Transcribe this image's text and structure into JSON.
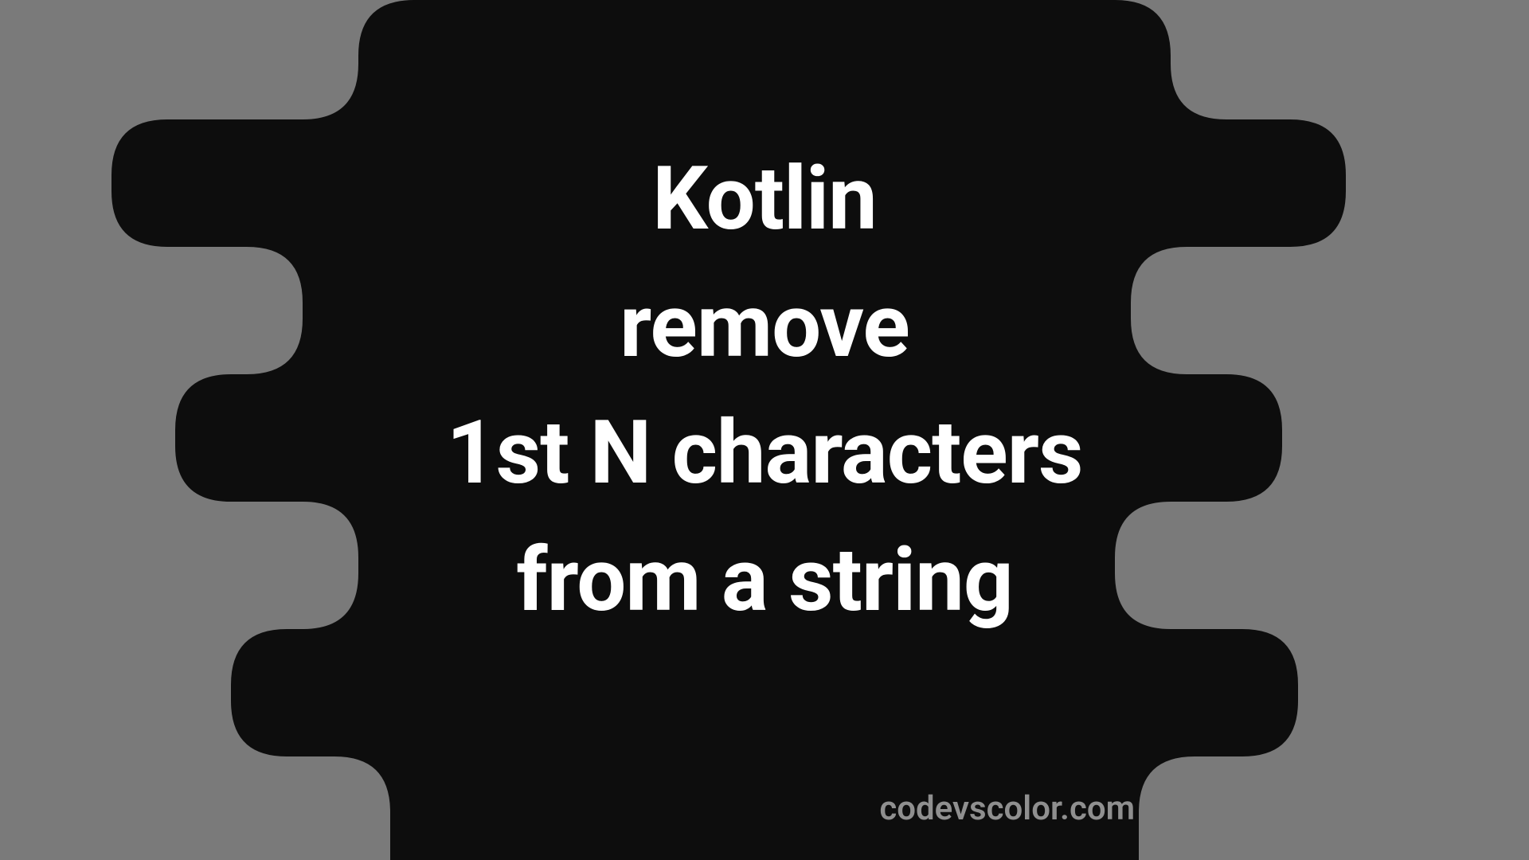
{
  "title": {
    "line1": "Kotlin",
    "line2": "remove",
    "line3": "1st N characters",
    "line4": "from a string"
  },
  "watermark": "codevscolor.com",
  "colors": {
    "background": "#7a7a7a",
    "blob": "#0d0d0d",
    "text": "#ffffff",
    "watermark": "#8f8f8f"
  }
}
